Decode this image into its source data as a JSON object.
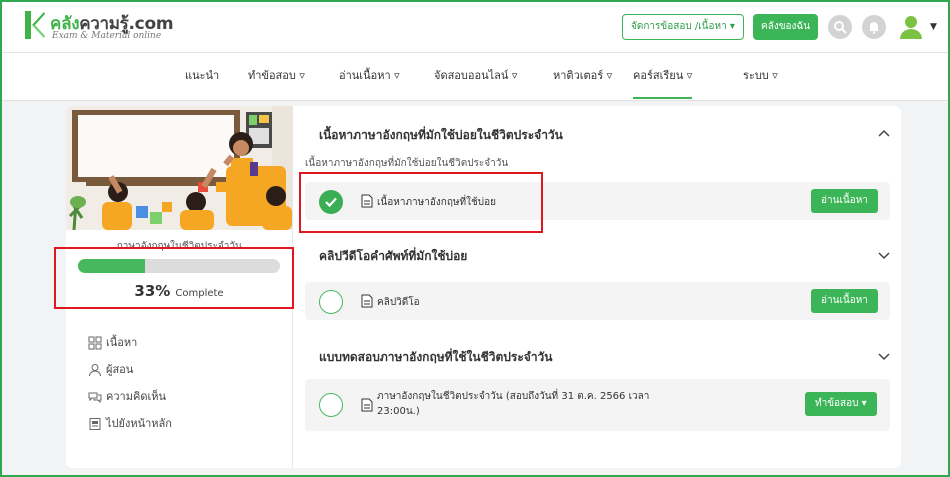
{
  "header": {
    "logo_title_green": "คลัง",
    "logo_title_dark": "ความรู้.com",
    "logo_subtitle": "Exam & Material online",
    "manage_button": "จัดการข้อสอบ /เนื้อหา ▾",
    "my_store_button": "คลังของฉัน",
    "icons": [
      "search-icon",
      "bell-icon",
      "user-avatar-icon"
    ]
  },
  "nav": {
    "items": [
      {
        "label": "แนะนำ"
      },
      {
        "label": "ทำข้อสอบ ▿"
      },
      {
        "label": "อ่านเนื้อหา ▿"
      },
      {
        "label": "จัดสอบออนไลน์ ▿"
      },
      {
        "label": "หาติวเตอร์ ▿"
      },
      {
        "label": "คอร์สเรียน ▿"
      },
      {
        "label": "ระบบ ▿"
      }
    ],
    "active_index": 5
  },
  "sidebar": {
    "course_title": "ภาษาอังกฤษในชีวิตประจำวัน",
    "progress_fraction": 0.33,
    "progress_percent": "33%",
    "progress_label": "Complete",
    "menu": [
      {
        "label": "เนื้อหา",
        "icon": "grid-icon"
      },
      {
        "label": "ผู้สอน",
        "icon": "person-icon"
      },
      {
        "label": "ความคิดเห็น",
        "icon": "comments-icon"
      },
      {
        "label": "ไปยังหน้าหลัก",
        "icon": "home-page-icon"
      }
    ]
  },
  "main": {
    "sections": [
      {
        "title": "เนื้อหาภาษาอังกฤษที่มักใช้บ่อยในชีวิตประจำวัน",
        "subtitle": "เนื้อหาภาษาอังกฤษที่มักใช้บ่อยในชีวิตประจำวัน",
        "expanded": true,
        "lesson": {
          "label": "เนื้อหาภาษาอังกฤษที่ใช้บ่อย",
          "status": "done",
          "button": "อ่านเนื้อหา"
        }
      },
      {
        "title": "คลิปวีดีโอคำศัพท์ที่มักใช้บ่อย",
        "expanded": false,
        "lesson": {
          "label": "คลิปวิดีโอ",
          "status": "todo",
          "button": "อ่านเนื้อหา"
        }
      },
      {
        "title": "แบบทดสอบภาษาอังกฤษที่ใช้ในชีวิตประจำวัน",
        "expanded": false,
        "lesson": {
          "label_line1": "ภาษาอังกฤษในชีวิตประจำวัน (สอบถึงวันที่ 31 ต.ค. 2566 เวลา",
          "label_line2": "23:00น.)",
          "status": "todo",
          "button": "ทำข้อสอบ ▾"
        }
      }
    ]
  },
  "colors": {
    "accent": "#3cb558",
    "highlight": "#e0171f",
    "progress_track": "#dcdcdc"
  }
}
